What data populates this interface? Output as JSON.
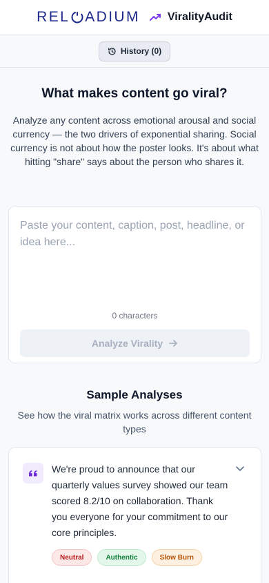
{
  "header": {
    "brand_prefix": "REL",
    "brand_suffix": "ADIUM",
    "app_name": "ViralityAudit",
    "brand_color": "#1e2a8a",
    "accent_color": "#7c3aed",
    "trend_icon": "trending-up-icon"
  },
  "history": {
    "label": "History (0)",
    "icon": "history-icon"
  },
  "hero": {
    "title": "What makes content go viral?",
    "description": "Analyze any content across emotional arousal and social currency — the two drivers of exponential sharing. Social currency is not about how the poster looks. It's about what hitting \"share\" says about the person who shares it."
  },
  "input": {
    "value": "",
    "placeholder": "Paste your content, caption, post, headline, or idea here...",
    "char_count": "0 characters",
    "analyze_label": "Analyze Virality"
  },
  "samples": {
    "title": "Sample Analyses",
    "subtitle": "See how the viral matrix works across different content types",
    "items": [
      {
        "text": "We're proud to announce that our quarterly values survey showed our team scored 8.2/10 on collaboration. Thank you everyone for your commitment to our core principles.",
        "tags": [
          "Neutral",
          "Authentic",
          "Slow Burn"
        ],
        "tag_colors": [
          "#b91c1c",
          "#15803d",
          "#b45309"
        ]
      }
    ]
  }
}
